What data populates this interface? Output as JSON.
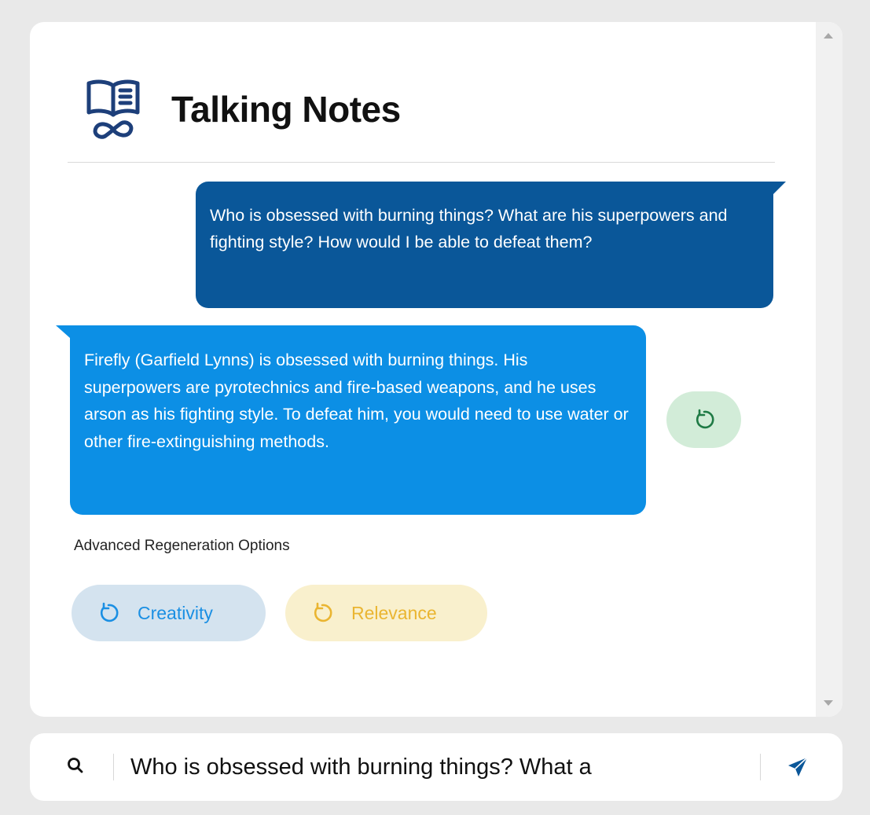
{
  "app": {
    "title": "Talking Notes"
  },
  "chat": {
    "user_message": "Who is obsessed with burning things? What are his superpowers and fighting style? How would I be able to defeat them?",
    "bot_message": "Firefly (Garfield Lynns) is obsessed with burning things. His superpowers are pyrotechnics and fire-based weapons, and he uses arson as his fighting style. To defeat him, you would need to use water or other fire-extinguishing methods."
  },
  "regeneration": {
    "title": "Advanced Regeneration Options",
    "creativity_label": "Creativity",
    "relevance_label": "Relevance"
  },
  "input": {
    "value": "Who is obsessed with burning things? What a"
  },
  "colors": {
    "user_bubble": "#0a5799",
    "bot_bubble": "#0c8fe5",
    "regen_green": "#1f7a45",
    "creativity_blue": "#1a8fe3",
    "relevance_yellow": "#eab531",
    "logo_navy": "#1d3f7a"
  },
  "icons": {
    "logo": "book-infinity-icon",
    "regenerate": "refresh-icon",
    "search": "search-icon",
    "send": "send-icon"
  }
}
